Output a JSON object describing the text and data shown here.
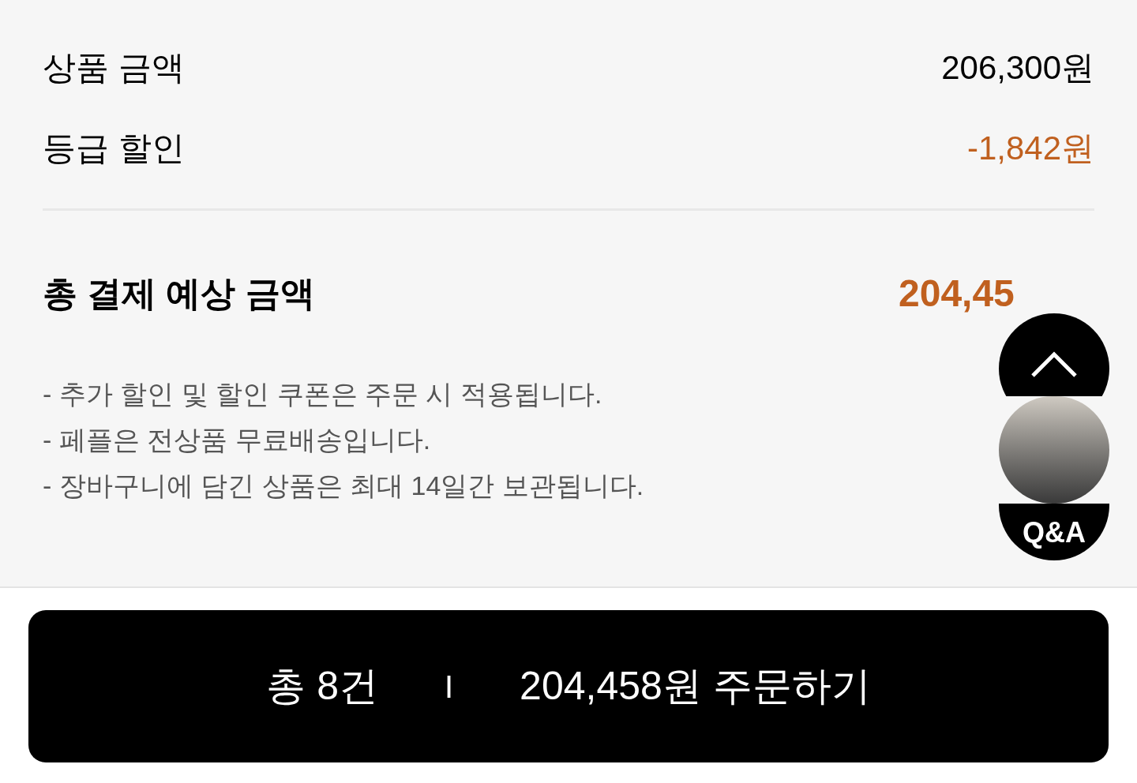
{
  "summary": {
    "rows": [
      {
        "label": "상품 금액",
        "value": "206,300원",
        "kind": "normal"
      },
      {
        "label": "등급 할인",
        "value": "-1,842원",
        "kind": "discount"
      }
    ],
    "total": {
      "label": "총 결제 예상 금액",
      "value": "204,45"
    },
    "notes": [
      "- 추가 할인 및 할인 쿠폰은 주문 시 적용됩니다.",
      "- 페플은 전상품 무료배송입니다.",
      "- 장바구니에 담긴 상품은 최대 14일간 보관됩니다."
    ]
  },
  "floating": {
    "qna": "Q&A"
  },
  "order_button": {
    "count": "총 8건",
    "separator": "I",
    "action": "204,458원 주문하기"
  }
}
